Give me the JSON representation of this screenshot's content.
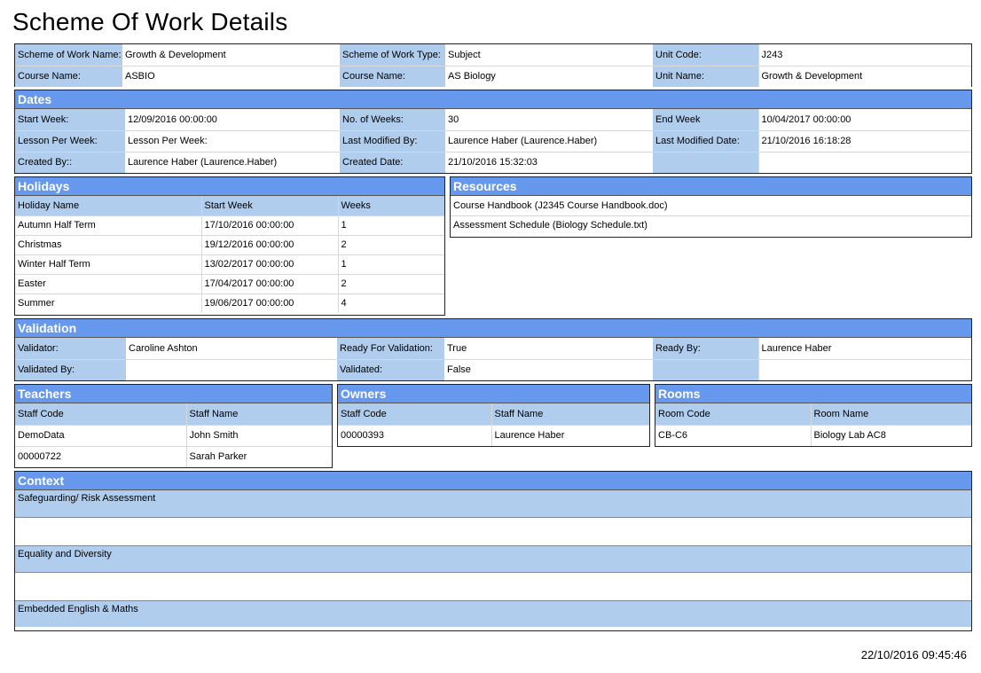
{
  "page": {
    "title": "Scheme Of Work Details",
    "timestamp": "22/10/2016 09:45:46"
  },
  "summary": {
    "rows": [
      [
        [
          "Scheme of Work Name:",
          "Growth & Development"
        ],
        [
          "Scheme of Work Type:",
          "Subject"
        ],
        [
          "Unit Code:",
          "J243"
        ]
      ],
      [
        [
          "Course Name:",
          "ASBIO"
        ],
        [
          "Course Name:",
          "AS Biology"
        ],
        [
          "Unit Name:",
          "Growth & Development"
        ]
      ]
    ]
  },
  "dates": {
    "header": "Dates",
    "rows": [
      [
        [
          "Start Week:",
          "12/09/2016 00:00:00"
        ],
        [
          "No. of Weeks:",
          "30"
        ],
        [
          "End Week",
          "10/04/2017 00:00:00"
        ]
      ],
      [
        [
          "Lesson Per Week:",
          "Lesson Per Week:"
        ],
        [
          "Last Modified By:",
          "Laurence Haber (Laurence.Haber)"
        ],
        [
          "Last Modified Date:",
          "21/10/2016 16:18:28"
        ]
      ],
      [
        [
          "Created By::",
          "Laurence Haber (Laurence.Haber)"
        ],
        [
          "Created Date:",
          "21/10/2016 15:32:03"
        ],
        [
          "",
          ""
        ]
      ]
    ]
  },
  "holidays": {
    "header": "Holidays",
    "columns": [
      "Holiday Name",
      "Start Week",
      "Weeks"
    ],
    "rows": [
      [
        "Autumn Half Term",
        "17/10/2016 00:00:00",
        "1"
      ],
      [
        "Christmas",
        "19/12/2016 00:00:00",
        "2"
      ],
      [
        "Winter Half Term",
        "13/02/2017 00:00:00",
        "1"
      ],
      [
        "Easter",
        "17/04/2017 00:00:00",
        "2"
      ],
      [
        "Summer",
        "19/06/2017 00:00:00",
        "4"
      ]
    ]
  },
  "resources": {
    "header": "Resources",
    "items": [
      "Course Handbook (J2345 Course Handbook.doc)",
      "Assessment Schedule (Biology Schedule.txt)"
    ]
  },
  "validation": {
    "header": "Validation",
    "rows": [
      [
        [
          "Validator:",
          "Caroline Ashton"
        ],
        [
          "Ready For Validation:",
          "True"
        ],
        [
          "Ready By:",
          "Laurence Haber"
        ]
      ],
      [
        [
          "Validated By:",
          ""
        ],
        [
          "Validated:",
          "False"
        ],
        [
          "",
          ""
        ]
      ]
    ]
  },
  "teachers": {
    "header": "Teachers",
    "columns": [
      "Staff Code",
      "Staff Name"
    ],
    "rows": [
      [
        "DemoData",
        "John Smith"
      ],
      [
        "00000722",
        "Sarah Parker"
      ]
    ]
  },
  "owners": {
    "header": "Owners",
    "columns": [
      "Staff Code",
      "Staff Name"
    ],
    "rows": [
      [
        "00000393",
        "Laurence Haber"
      ]
    ]
  },
  "rooms": {
    "header": "Rooms",
    "columns": [
      "Room Code",
      "Room Name"
    ],
    "rows": [
      [
        "CB-C6",
        "Biology Lab AC8"
      ]
    ]
  },
  "context": {
    "header": "Context",
    "sections": [
      {
        "label": "Safeguarding/ Risk Assessment",
        "content": ""
      },
      {
        "label": "Equality and Diversity",
        "content": ""
      },
      {
        "label": "Embedded English & Maths",
        "content": ""
      }
    ]
  }
}
